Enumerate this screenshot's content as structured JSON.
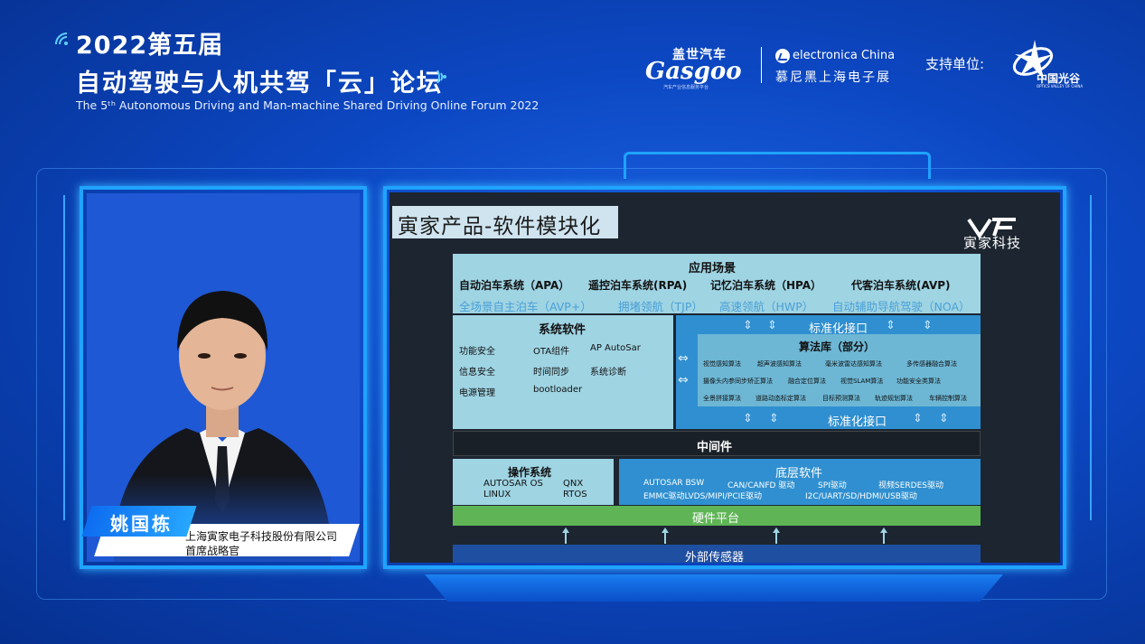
{
  "header": {
    "title_line1": "2022第五届",
    "title_line2": "自动驾驶与人机共驾「云」论坛",
    "subtitle": "The 5ᵗʰ Autonomous Driving and Man-machine Shared Driving Online Forum 2022"
  },
  "sponsors": {
    "gasgoo_cn": "盖世汽车",
    "gasgoo_en": "Gasgoo",
    "gasgoo_tag": "汽车产业信息服务平台",
    "electronica_en": "electronica China",
    "electronica_cn": "慕尼黑上海电子展",
    "support_label": "支持单位:",
    "optics_valley_cn": "中国光谷",
    "optics_valley_en": "OPTICS VALLEY OF CHINA"
  },
  "speaker": {
    "name": "姚国栋",
    "company": "上海寅家电子科技股份有限公司",
    "role": "首席战略官"
  },
  "slide": {
    "title": "寅家产品-软件模块化",
    "logo_text": "寅家科技",
    "app": {
      "header": "应用场景",
      "row1": [
        "自动泊车系统（APA）",
        "遥控泊车系统(RPA)",
        "记忆泊车系统（HPA）",
        "代客泊车系统(AVP)"
      ],
      "row2": [
        "全场景自主泊车（AVP+）",
        "拥堵领航（TJP）",
        "高速领航（HWP）",
        "自动辅助导航驾驶（NOA）"
      ]
    },
    "system": {
      "header": "系统软件",
      "items": [
        "功能安全",
        "OTA组件",
        "AP AutoSar",
        "信息安全",
        "时间同步",
        "系统诊断",
        "电源管理",
        "bootloader"
      ]
    },
    "interface_top": "标准化接口",
    "interface_bottom": "标准化接口",
    "algorithms": {
      "header": "算法库（部分）",
      "items": [
        "视觉感知算法",
        "超声波感知算法",
        "毫米波雷达感知算法",
        "多传感器融合算法",
        "摄像头内参同步矫正算法",
        "融合定位算法",
        "视觉SLAM算法",
        "功能安全类算法",
        "全景拼接算法",
        "道路动态标定算法",
        "目标预测算法",
        "轨迹规划算法",
        "车辆控制算法"
      ]
    },
    "middleware": "中间件",
    "os": {
      "header": "操作系统",
      "items": [
        "AUTOSAR OS",
        "QNX",
        "LINUX",
        "RTOS"
      ]
    },
    "lowlevel": {
      "header": "底层软件",
      "items": [
        "AUTOSAR BSW",
        "CAN/CANFD 驱动",
        "SPI驱动",
        "视频SERDES驱动",
        "EMMC驱动LVDS/MIPI/PCIE驱动",
        "I2C/UART/SD/HDMI/USB驱动"
      ]
    },
    "hardware": "硬件平台",
    "sensors": "外部传感器"
  }
}
